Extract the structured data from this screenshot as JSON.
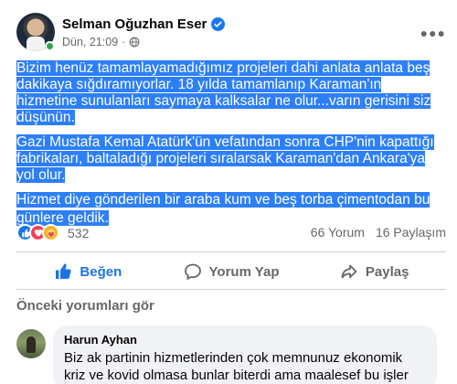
{
  "post": {
    "author": "Selman Oğuzhan Eser",
    "timestamp": "Dün, 21:09",
    "paragraphs": [
      "Bizim henüz tamamlayamadığımız projeleri dahi anlata anlata beş dakikaya sığdıramıyorlar. 18 yılda tamamlanıp Karaman'ın hizmetine sunulanları saymaya kalksalar ne olur...varın gerisini siz düşünün.",
      "Gazi Mustafa Kemal Atatürk'ün vefatından sonra CHP'nin kapattığı fabrikaları, baltaladığı projeleri sıralarsak Karaman'dan Ankara'ya yol olur.",
      "Hizmet diye gönderilen bir araba kum ve beş torba çimentodan bu günlere geldik."
    ],
    "text_selected": true
  },
  "icons": {
    "verified": "verified-badge-icon",
    "audience": "globe-icon",
    "more": "more-options-icon",
    "like": "thumbs-up-icon",
    "comment": "comment-bubble-icon",
    "share": "share-arrow-icon"
  },
  "stats": {
    "reaction_count": "532",
    "comments": "66 Yorum",
    "shares": "16 Paylaşım"
  },
  "actions": {
    "like": "Beğen",
    "comment": "Yorum Yap",
    "share": "Paylaş"
  },
  "comments_section": {
    "previous_label": "Önceki yorumları gör",
    "items": [
      {
        "name": "Harun Ayhan",
        "text": "Biz ak partinin hizmetlerinden çok memnunuz ekonomik kriz ve kovid olmasa bunlar biterdi ama maalesef bu işler"
      }
    ]
  },
  "colors": {
    "selection": "#2d7ff9",
    "liked": "#1b74e4",
    "verified": "#1877f2",
    "online": "#31a24c"
  }
}
